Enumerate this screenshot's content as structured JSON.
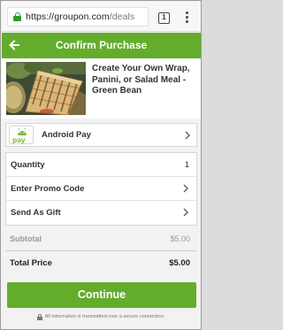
{
  "browser": {
    "url_host": "https://groupon.com",
    "url_path": "/deals",
    "tab_count": "1"
  },
  "header": {
    "title": "Confirm Purchase"
  },
  "product": {
    "title": "Create Your Own Wrap, Panini, or Salad Meal - Green Bean"
  },
  "payment": {
    "logo_text": "pay",
    "label": "Android Pay"
  },
  "options": [
    {
      "label": "Quantity",
      "value": "1"
    },
    {
      "label": "Enter Promo Code",
      "value": ""
    },
    {
      "label": "Send As Gift",
      "value": ""
    }
  ],
  "summary": {
    "subtotal_label": "Subtotal",
    "subtotal_value": "$5.00",
    "total_label": "Total Price",
    "total_value": "$5.00"
  },
  "continue_label": "Continue",
  "footer_text": "All information is transmitted over a secure connection.",
  "colors": {
    "brand_green": "#64ad2c",
    "secure_lock_green": "#2a9d2a"
  },
  "icons": [
    "lock-icon",
    "tabs-icon",
    "overflow-menu-icon",
    "back-arrow-icon",
    "android-pay-icon",
    "chevron-right-icon"
  ]
}
